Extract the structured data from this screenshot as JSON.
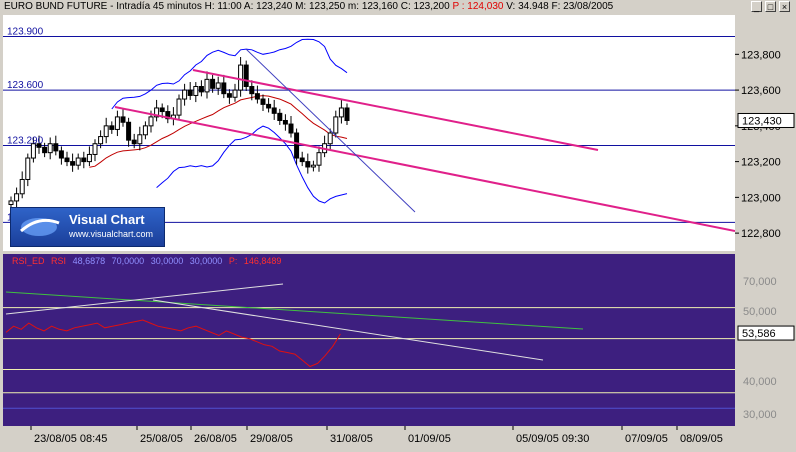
{
  "title_bar": {
    "name": "EURO BUND FUTURE - Intradía 45 minutos",
    "h_label": "H:",
    "h_value": "11:00",
    "a_label": "A:",
    "a_value": "123,240",
    "m_label": "M:",
    "m_value": "123,250",
    "m2_label": "m:",
    "m2_value": "123,160",
    "c_label": "C:",
    "c_value": "123,200",
    "p_label": "P :",
    "p_value": "124,030",
    "v_label": "V:",
    "v_value": "34.948",
    "f_label": "F:",
    "f_value": "23/08/2005",
    "buttons": {
      "minimize": "_",
      "maximize": "□",
      "close": "×"
    }
  },
  "logo": {
    "name": "Visual Chart",
    "url": "www.visualchart.com"
  },
  "rsi_legend": {
    "ind1": "RSI_ED",
    "ind2": "RSI",
    "v1": "48,6878",
    "v2": "70,0000",
    "v3": "30,0000",
    "v4": "30,0000",
    "p_label": "P:",
    "p_value": "146,8489",
    "colors": {
      "ind1": "#e00000",
      "ind2": "#ffffff",
      "p": "#ff0000"
    }
  },
  "colors": {
    "price_bg": "#ffffff",
    "rsi_bg": "#3d1f7f",
    "candle_up": "#ffffff",
    "candle_down": "#000000",
    "channel": "#e0208a",
    "sma_fast": "#c00000",
    "bollinger": "#0000ff",
    "trendline": "#4040c0",
    "rsi_line": "#e01010",
    "rsi_trend_green": "#40c040",
    "rsi_trend_white": "#e0e0e0",
    "hline_blue": "#1010a0",
    "hline_yellow": "#f0f0b0"
  },
  "chart_data": [
    {
      "type": "candlestick",
      "title": "EURO BUND FUTURE - Intradía 45 minutos",
      "price_range": [
        122.7,
        124.02
      ],
      "yticks": [
        "123,800",
        "123,600",
        "123,400",
        "123,200",
        "123,000",
        "122,800"
      ],
      "current_price_label": "123,430",
      "horizontal_levels": [
        {
          "label": "123.900",
          "value": 123.9
        },
        {
          "label": "123.600",
          "value": 123.6
        },
        {
          "label": "123.290",
          "value": 123.29
        },
        {
          "label": "122.860",
          "value": 122.86
        }
      ],
      "candles_close": [
        122.98,
        123.02,
        123.1,
        123.22,
        123.3,
        123.28,
        123.25,
        123.3,
        123.26,
        123.22,
        123.2,
        123.18,
        123.22,
        123.2,
        123.24,
        123.3,
        123.34,
        123.4,
        123.38,
        123.45,
        123.42,
        123.32,
        123.3,
        123.35,
        123.4,
        123.45,
        123.5,
        123.48,
        123.44,
        123.46,
        123.55,
        123.6,
        123.57,
        123.62,
        123.59,
        123.66,
        123.61,
        123.64,
        123.58,
        123.56,
        123.6,
        123.74,
        123.62,
        123.58,
        123.55,
        123.52,
        123.5,
        123.47,
        123.43,
        123.41,
        123.36,
        123.22,
        123.2,
        123.17,
        123.18,
        123.25,
        123.3,
        123.36,
        123.45,
        123.5,
        123.43
      ]
    },
    {
      "type": "line",
      "title": "RSI",
      "y_range": [
        0,
        100
      ],
      "yticks": [
        "70,000",
        "50,000",
        "40,000",
        "30,000"
      ],
      "current_value_label": "53,586",
      "series": [
        {
          "name": "RSI_ED",
          "values": [
            54,
            58,
            56,
            60,
            57,
            55,
            58,
            56,
            55,
            57,
            58,
            59,
            60,
            57,
            58,
            59,
            60,
            61,
            62,
            60,
            58,
            57,
            56,
            55,
            57,
            58,
            56,
            54,
            52,
            55,
            53,
            51,
            50,
            48,
            46,
            45,
            42,
            41,
            40,
            36,
            32,
            34,
            39,
            45,
            53
          ]
        }
      ]
    }
  ],
  "xaxis_labels": [
    "23/08/05 08:45",
    "25/08/05",
    "26/08/05",
    "29/08/05",
    "31/08/05",
    "01/09/05",
    "05/09/05 09:30",
    "07/09/05",
    "08/09/05"
  ]
}
